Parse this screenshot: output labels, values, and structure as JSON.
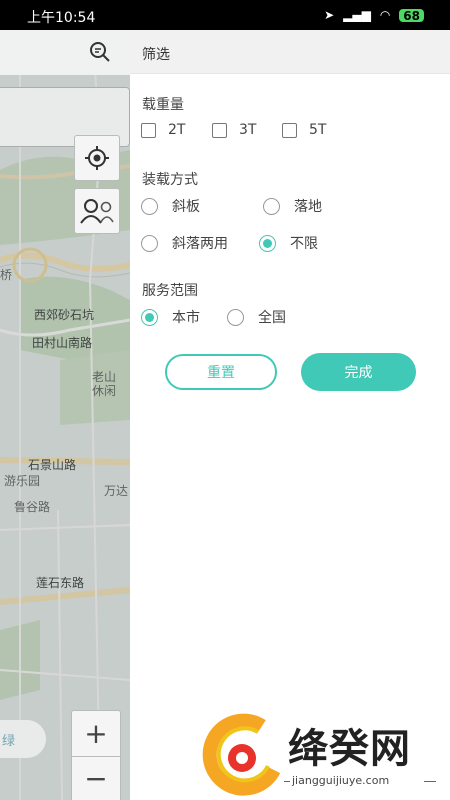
{
  "status_bar": {
    "time": "上午10:54",
    "battery": "68",
    "signal_text": "↗ .⁙ ◠"
  },
  "map": {
    "labels": [
      "西郊砂石坑",
      "田村山南路",
      "老山",
      "休闲",
      "石景山路",
      "游乐园",
      "万达",
      "鲁谷路",
      "莲石东路",
      "桥"
    ],
    "pill_label": "绿",
    "zoom_in": "+",
    "zoom_out": "−"
  },
  "filter": {
    "title": "筛选",
    "load_weight": {
      "title": "载重量",
      "options": [
        "2T",
        "3T",
        "5T"
      ]
    },
    "loading_method": {
      "title": "装载方式",
      "options": [
        "斜板",
        "落地",
        "斜落两用",
        "不限"
      ],
      "selected": "不限"
    },
    "service_area": {
      "title": "服务范围",
      "options": [
        "本市",
        "全国"
      ],
      "selected": "本市"
    },
    "reset_label": "重置",
    "done_label": "完成"
  },
  "watermark": {
    "text": "绛癸网",
    "url": "jiangguijiuye.com"
  },
  "colors": {
    "accent": "#40c9b6",
    "header_bg": "#f1f1f1",
    "map_bg": "#c5cbc9",
    "status_bg": "#000000"
  }
}
